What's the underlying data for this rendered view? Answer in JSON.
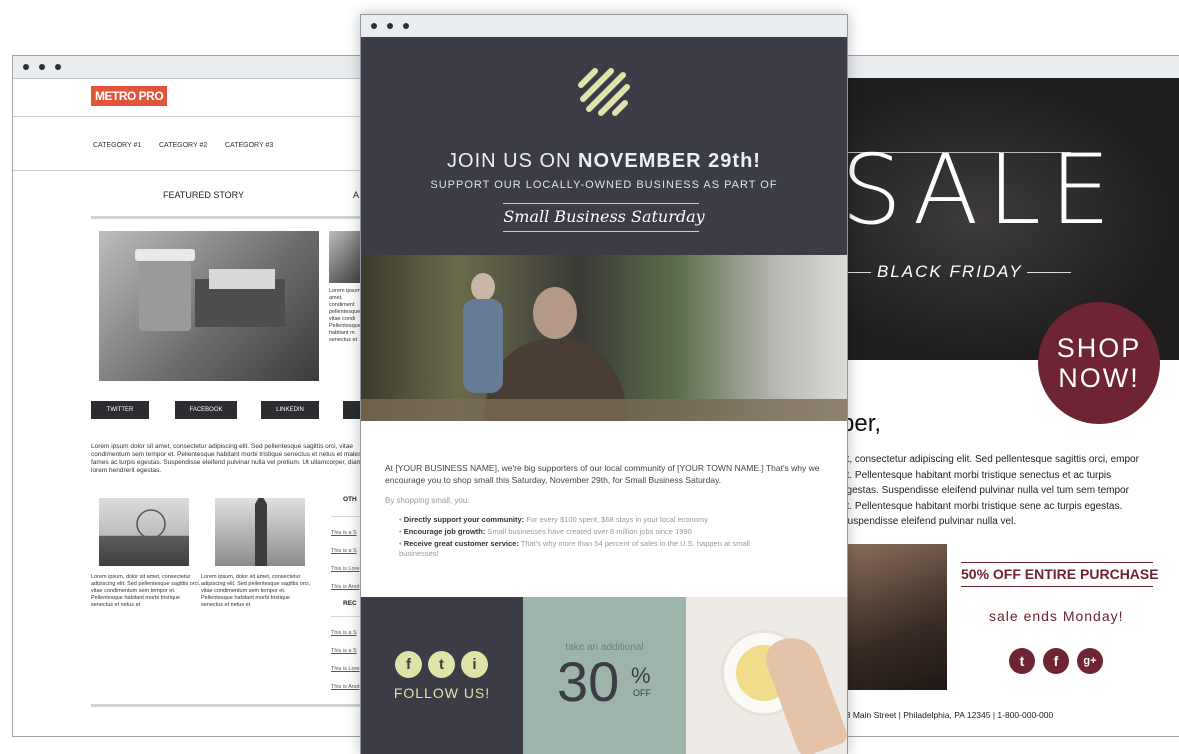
{
  "left_window": {
    "logo": "METRO PRO",
    "categories": [
      "CATEGORY #1",
      "CATEGORY #2",
      "CATEGORY #3"
    ],
    "featured_label": "FEATURED STORY",
    "featured_label_2": "A",
    "teaser_text": "Lorem ipsum amet, condiment pellentesque vitae condi Pellentesque habitant m senectus et",
    "social_buttons": [
      "TWITTER",
      "FACEBOOK",
      "LINKEDIN"
    ],
    "body_text": "Lorem ipsum dolor sit amet, consectetur adipiscing elit. Sed pellentesque sagittis orci, vitae condimentum sem tempor et. Pellentesque habitant morbi tristique senectus et netus et malesuada fames ac turpis egestas. Suspendisse eleifend pulvinar nulla vel pretium. Ut ullamcorper, diam ut lorem hendrerit egestas.",
    "card1_text": "Lorem ipsum, dolor sit amet, consectetur adipiscing elit. Sed pellentesque sagittis orci, vitae condimentum sem tempor et. Pellentesque habitant morbi tristique senectus et netus et",
    "card2_text": "Lorem ipsum, dolor sit amet, consectetur adipiscing elit. Sed pellentesque sagittis orci, vitae condimentum sem tempor et. Pellentesque habitant morbi tristique senectus et netus et",
    "side_heading_1": "OTH",
    "side_links_1": [
      "This is a S",
      "This is a S",
      "This is Lore",
      "This is Anot"
    ],
    "side_heading_2": "REC",
    "side_links_2": [
      "This is a S",
      "This is a S",
      "This is Lore",
      "This is Anot"
    ]
  },
  "center_window": {
    "headline_prefix": "JOIN US ON ",
    "headline_bold": "NOVEMBER 29th!",
    "support_line": "SUPPORT OUR LOCALLY-OWNED BUSINESS AS PART OF",
    "event_name": "Small Business Saturday",
    "intro": "At [YOUR BUSINESS NAME], we're big supporters of our local community of [YOUR TOWN NAME.] That's why we encourage you to shop small this Saturday, November 29th, for Small Business Saturday.",
    "by_shopping": "By shopping small, you:",
    "bullets": [
      {
        "bold": "Directly support your community:",
        "text": " For every $100 spent, $68 stays in your local economy"
      },
      {
        "bold": "Encourage job growth:",
        "text": " Small businesses have created over 8 million jobs since 1990"
      },
      {
        "bold": "Receive great customer service:",
        "text": " That's why more than 54 percent of sales in the U.S. happen at small businesses!"
      }
    ],
    "social_icons": [
      "f",
      "t",
      "i"
    ],
    "follow_label": "FOLLOW US!",
    "take_label": "take an additional",
    "discount_number": "30",
    "discount_percent": "%",
    "discount_off": "OFF"
  },
  "right_window": {
    "sale_word": "SALE",
    "black_friday": "BLACK FRIDAY",
    "shop_line1": "SHOP",
    "shop_line2": "NOW!",
    "heading_fragment": "ber,",
    "body_text": "et, consectetur adipiscing elit. Sed pellentesque sagittis orci, empor et. Pellentesque habitant morbi tristique senectus et ac turpis egestas. Suspendisse eleifend pulvinar nulla vel tum sem tempor et. Pellentesque habitant morbi tristique sene ac turpis egestas. Suspendisse eleifend pulvinar nulla vel.",
    "offer": "50% OFF ENTIRE PURCHASE",
    "sale_ends": "sale ends Monday!",
    "social_icons": [
      "t",
      "f",
      "g+"
    ],
    "address": "23 Main Street | Philadelphia, PA 12345 | 1-800-000-000"
  },
  "colors": {
    "metro_accent": "#e2543c",
    "center_dark": "#3b3c45",
    "center_sage": "#9cb4a9",
    "center_icon": "#dfe3a8",
    "sale_maroon": "#6e2432"
  }
}
